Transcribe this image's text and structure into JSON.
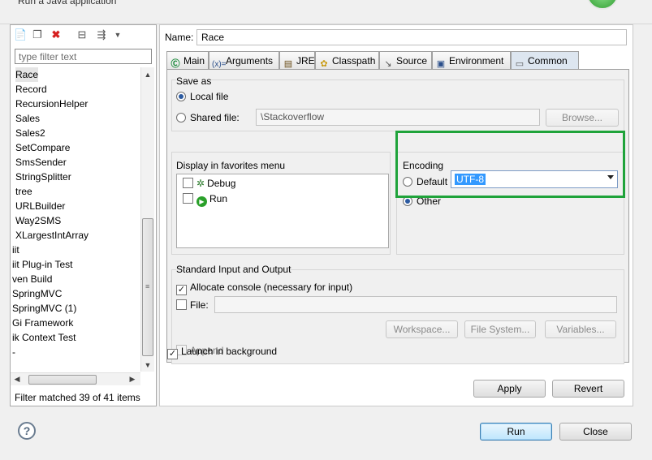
{
  "window": {
    "title": "Run a Java application"
  },
  "left": {
    "filter_placeholder": "type filter text",
    "items": [
      "Race",
      "Record",
      "RecursionHelper",
      "Sales",
      "Sales2",
      "SetCompare",
      "SmsSender",
      "StringSplitter",
      "tree",
      "URLBuilder",
      "Way2SMS",
      "XLargestIntArray",
      "iit",
      "iit Plug-in Test",
      "ven Build",
      "SpringMVC",
      "SpringMVC (1)",
      "Gi Framework",
      "ik Context Test",
      "-"
    ],
    "selected_index": 0,
    "status": "Filter matched 39 of 41 items"
  },
  "config": {
    "name_label": "Name:",
    "name_value": "Race",
    "tabs": [
      {
        "label": "Main",
        "icon": "main-tab-icon"
      },
      {
        "label": "Arguments",
        "icon": "arguments-tab-icon"
      },
      {
        "label": "JRE",
        "icon": "jre-tab-icon"
      },
      {
        "label": "Classpath",
        "icon": "classpath-tab-icon"
      },
      {
        "label": "Source",
        "icon": "source-tab-icon"
      },
      {
        "label": "Environment",
        "icon": "environment-tab-icon"
      },
      {
        "label": "Common",
        "icon": "common-tab-icon"
      }
    ],
    "active_tab": "Common",
    "save_as": {
      "title": "Save as",
      "local_label": "Local file",
      "shared_label": "Shared file:",
      "shared_value": "\\Stackoverflow",
      "browse_label": "Browse..."
    },
    "favorites": {
      "title": "Display in favorites menu",
      "items": [
        "Debug",
        "Run"
      ]
    },
    "encoding": {
      "title": "Encoding",
      "default_label": "Default - inherited (UTF-8)",
      "other_label": "Other",
      "other_value": "UTF-8"
    },
    "stdio": {
      "title": "Standard Input and Output",
      "allocate_label": "Allocate console (necessary for input)",
      "file_label": "File:",
      "workspace_label": "Workspace...",
      "filesystem_label": "File System...",
      "variables_label": "Variables...",
      "append_label": "Append"
    },
    "launch_bg_label": "Launch in background",
    "apply_label": "Apply",
    "revert_label": "Revert"
  },
  "footer": {
    "help": "?",
    "run_label": "Run",
    "close_label": "Close"
  },
  "colors": {
    "highlight_border": "#1fa33a",
    "selection": "#3399ff"
  }
}
